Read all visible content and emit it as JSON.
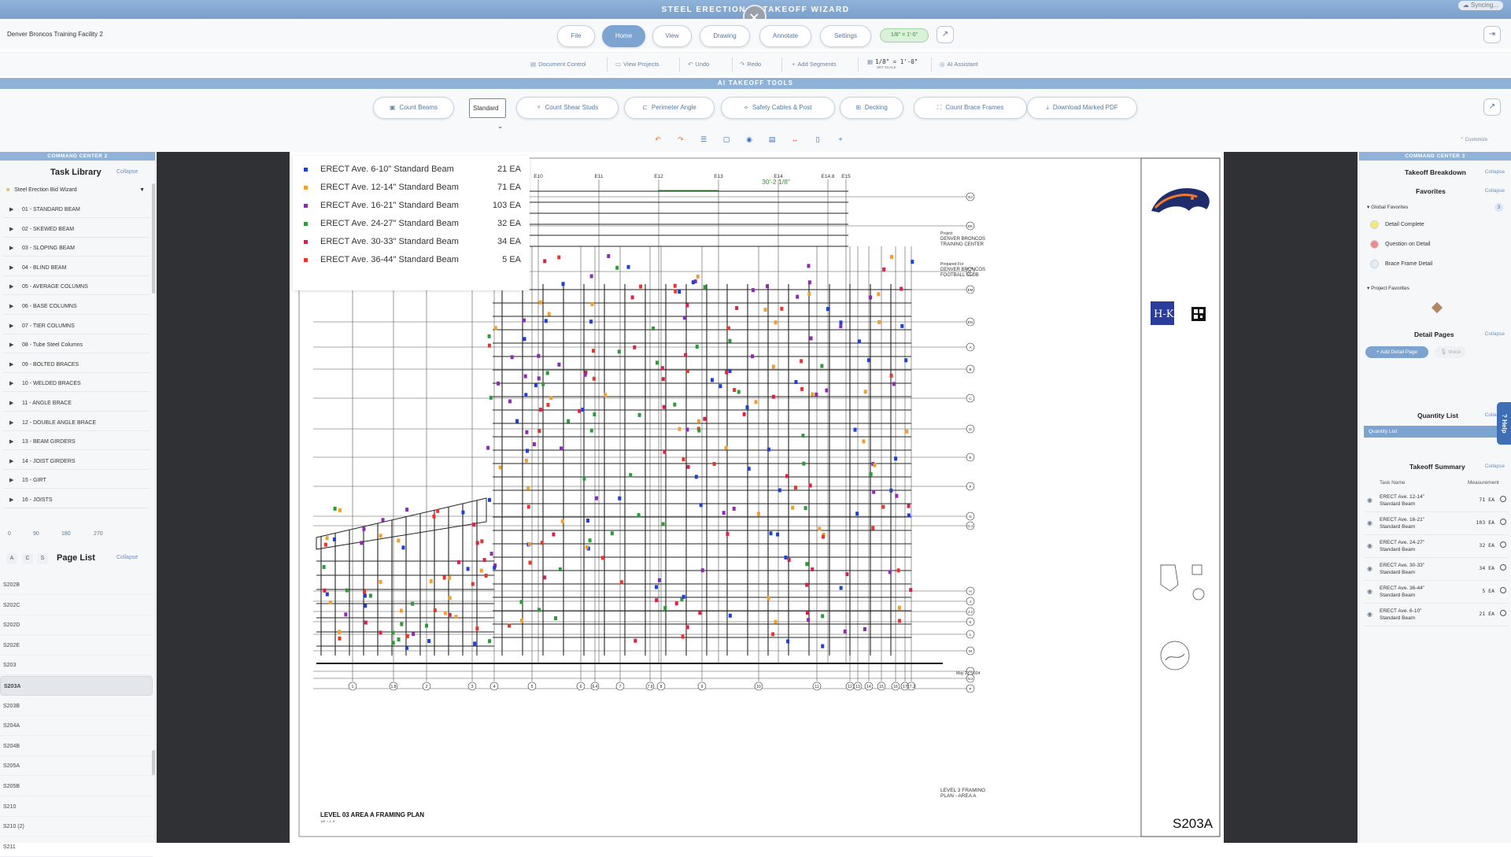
{
  "app": {
    "title": "STEEL ERECTION AI TAKEOFF WIZARD",
    "close_glyph": "✕",
    "sync_status": "Syncing..."
  },
  "topbar": {
    "project_name": "Denver Broncos Training Facility 2",
    "tabs": [
      {
        "label": "File"
      },
      {
        "label": "Home"
      },
      {
        "label": "View"
      },
      {
        "label": "Drawing"
      },
      {
        "label": "Annotate"
      },
      {
        "label": "Settings"
      }
    ],
    "scale": "1/8\" = 1'-0\""
  },
  "subbar": {
    "items": [
      {
        "label": "Document Control",
        "icon": "document-icon"
      },
      {
        "label": "View Projects",
        "icon": "folder-icon"
      },
      {
        "label": "Undo",
        "icon": "undo-icon"
      },
      {
        "label": "Redo",
        "icon": "redo-icon"
      },
      {
        "label": "Add Segments",
        "icon": "plus-icon"
      },
      {
        "label": "1/8\" = 1'-0\"",
        "sub": "SET SCALE",
        "icon": "scale-icon"
      },
      {
        "label": "AI Assistant",
        "icon": "assistant-icon"
      }
    ]
  },
  "ai_tools": {
    "header": "AI TAKEOFF TOOLS",
    "buttons": [
      {
        "label": "Count Beams"
      },
      {
        "label": "Count Shear Studs"
      },
      {
        "label": "Perimeter Angle"
      },
      {
        "label": "Safety Cables & Post"
      },
      {
        "label": "Decking"
      },
      {
        "label": "Count Brace Frames"
      },
      {
        "label": "Download Marked PDF"
      }
    ],
    "beam_type_select": "Standard",
    "customize": "Customize"
  },
  "left_panel": {
    "header": "COMMAND CENTER 2",
    "task_library_title": "Task Library",
    "collapse": "Collapse",
    "folder": "Steel Erection Bid Wizard",
    "tasks": [
      "01 - STANDARD BEAM",
      "02 - SKEWED BEAM",
      "03 - SLOPING BEAM",
      "04 - BLIND BEAM",
      "05 - AVERAGE COLUMNS",
      "06 - BASE COLUMNS",
      "07 - TIER COLUMNS",
      "08 - Tube Steel Columns",
      "09 - BOLTED BRACES",
      "10 - WELDED BRACES",
      "11 - ANGLE BRACE",
      "12 - DOUBLE ANGLE BRACE",
      "13 - BEAM GIRDERS",
      "14 - JOIST GIRDERS",
      "15 - GIRT",
      "16 - JOISTS"
    ],
    "rotations": [
      "0",
      "90",
      "180",
      "270"
    ],
    "sort_buttons": [
      "A",
      "C",
      "S"
    ],
    "page_list_title": "Page List",
    "pages": [
      "S202B",
      "S202C",
      "S202D",
      "S202E",
      "S203",
      "S203A",
      "S203B",
      "S204A",
      "S204B",
      "S205A",
      "S205B",
      "S210",
      "S210 (2)",
      "S211"
    ],
    "active_page": "S203A"
  },
  "legend": {
    "rows": [
      {
        "label": "ERECT Ave. 6-10\" Standard Beam",
        "count": "21 EA",
        "color": "#1f3fd6"
      },
      {
        "label": "ERECT Ave. 12-14\" Standard Beam",
        "count": "71 EA",
        "color": "#f0a030"
      },
      {
        "label": "ERECT Ave. 16-21\" Standard Beam",
        "count": "103 EA",
        "color": "#8e2bb0"
      },
      {
        "label": "ERECT Ave. 24-27\" Standard Beam",
        "count": "32 EA",
        "color": "#2e9a3a"
      },
      {
        "label": "ERECT Ave. 30-33\" Standard Beam",
        "count": "34 EA",
        "color": "#d6234a"
      },
      {
        "label": "ERECT Ave. 36-44\" Standard Beam",
        "count": "5 EA",
        "color": "#e5372b"
      }
    ]
  },
  "drawing": {
    "dimension": "30'-2 1/8\"",
    "plan_title": "LEVEL 03 AREA A FRAMING PLAN",
    "plan_scale": "1/8\" = 1'-0\"",
    "col_grid": [
      "E10",
      "E11",
      "E12",
      "E13",
      "E14",
      "E14.8",
      "E15"
    ],
    "bottom_grid": [
      "1",
      "1.8",
      "2",
      "3",
      "4",
      "5",
      "6",
      "6.4",
      "7",
      "7.9",
      "8",
      "9",
      "10",
      "11",
      "12",
      "13",
      "14",
      "15",
      "16",
      "17",
      "17.2"
    ],
    "row_grid": [
      "EJ",
      "EK",
      "EL",
      "EM",
      "EN",
      "A",
      "B",
      "C",
      "D",
      "E",
      "F",
      "G",
      "G.2",
      "H",
      "J",
      "J.2",
      "K",
      "L",
      "M",
      "N",
      "N.2",
      "P"
    ],
    "title_block": {
      "project_label": "Project",
      "project": "DENVER BRONCOS TRAINING CENTER",
      "prepared_for_label": "Prepared For",
      "client": "DENVER BRONCOS FOOTBALL CLUB",
      "sheet_title": "LEVEL 3 FRAMING PLAN - AREA A",
      "sheet_number": "S203A",
      "seal_date": "May 23, 2024"
    }
  },
  "right_panel": {
    "header": "COMMAND CENTER 3",
    "takeoff_breakdown": "Takeoff Breakdown",
    "collapse": "Collapse",
    "favorites": "Favorites",
    "global_favorites": "Global Favorites",
    "global_count": "3",
    "fav_items": [
      {
        "label": "Detail Complete",
        "color": "#f5e97a"
      },
      {
        "label": "Question on Detail",
        "color": "#ef8a8a"
      },
      {
        "label": "Brace Frame Detail",
        "color": "#e3ebf5"
      }
    ],
    "project_favorites": "Project Favorites",
    "detail_pages": "Detail Pages",
    "add_detail_page": "+ Add Detail Page",
    "voice": "Voice",
    "quantity_list_title": "Quantity List",
    "quantity_list_item": "Quantity List",
    "takeoff_summary": "Takeoff Summary",
    "col_task": "Task Name",
    "col_measure": "Measurement",
    "summary_rows": [
      {
        "name": "ERECT Ave. 12-14\" Standard Beam",
        "value": "71 EA"
      },
      {
        "name": "ERECT Ave. 16-21\" Standard Beam",
        "value": "103 EA"
      },
      {
        "name": "ERECT Ave. 24-27\" Standard Beam",
        "value": "32 EA"
      },
      {
        "name": "ERECT Ave. 30-33\" Standard Beam",
        "value": "34 EA"
      },
      {
        "name": "ERECT Ave. 36-44\" Standard Beam",
        "value": "5 EA"
      },
      {
        "name": "ERECT Ave. 6-10\" Standard Beam",
        "value": "21 EA"
      }
    ],
    "help": "Help"
  }
}
